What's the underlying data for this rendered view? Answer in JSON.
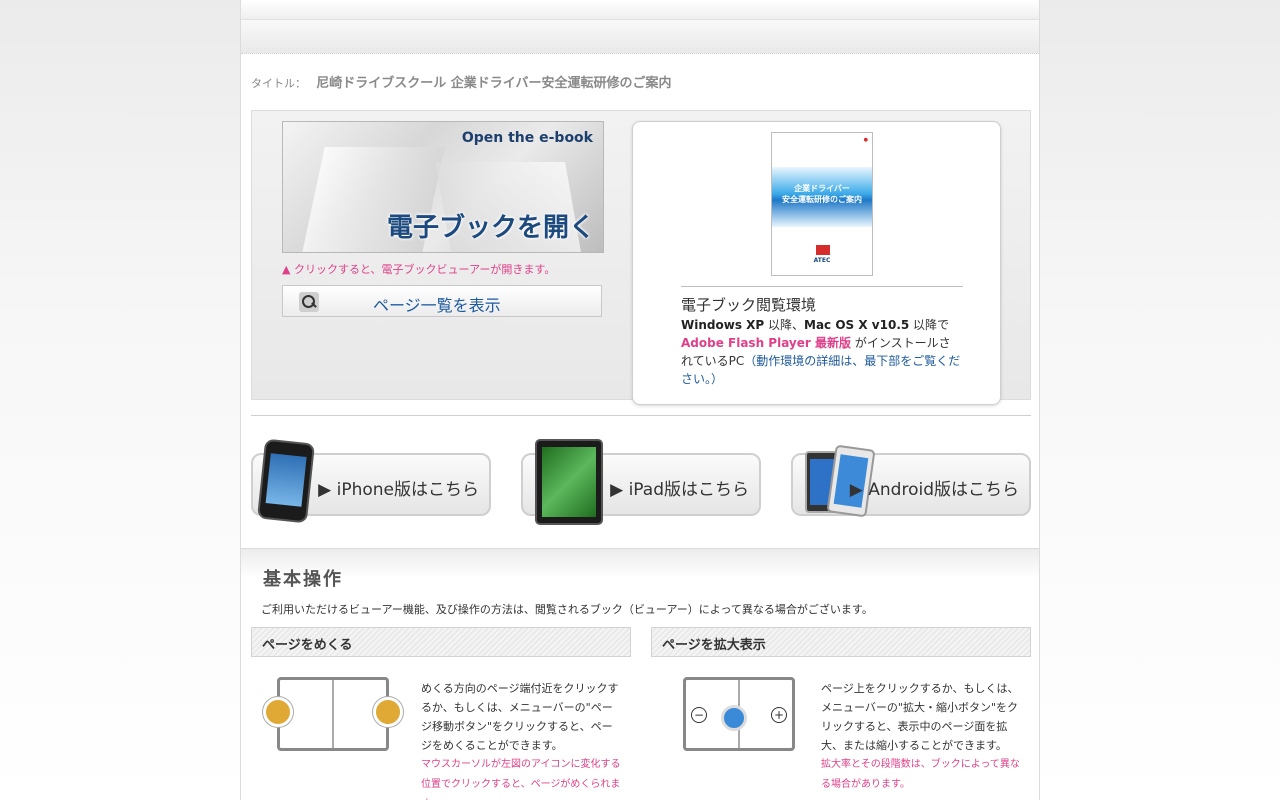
{
  "title": {
    "label": "タイトル：",
    "value": "尼崎ドライブスクール 企業ドライバー安全運転研修のご案内"
  },
  "open_book": {
    "en_label": "Open the e-book",
    "jp_label": "電子ブックを開く",
    "note": "▲ クリックすると、電子ブックビューアーが開きます。"
  },
  "page_list": {
    "label": "ページ一覧を表示"
  },
  "cover": {
    "title_line1": "企業ドライバー",
    "title_line2": "安全運転研修のご案内",
    "logo_text": "ATEC"
  },
  "environment": {
    "title": "電子ブック閲覧環境",
    "os_xp": "Windows XP",
    "os_connector": " 以降、",
    "os_mac": "Mac OS X v10.5",
    "os_suffix": " 以降で",
    "flash": "Adobe Flash Player 最新版",
    "installed": " がインストールされているPC",
    "detail": "（動作環境の詳細は、最下部をご覧ください。）"
  },
  "devices": [
    {
      "label": "▶ iPhone版はこちら"
    },
    {
      "label": "▶ iPad版はこちら"
    },
    {
      "label": "▶ Android版はこちら"
    }
  ],
  "operations": {
    "title": "基本操作",
    "description": "ご利用いただけるビューアー機能、及び操作の方法は、閲覧されるブック（ビューアー）によって異なる場合がございます。",
    "turn": {
      "heading": "ページをめくる",
      "text": "めくる方向のページ端付近をクリックするか、もしくは、メニューバーの\"ページ移動ボタン\"をクリックすると、ページをめくることができます。",
      "note": "マウスカーソルが左図のアイコンに変化する位置でクリックすると、ページがめくられます。"
    },
    "zoom": {
      "heading": "ページを拡大表示",
      "text": "ページ上をクリックするか、もしくは、メニューバーの\"拡大・縮小ボタン\"をクリックすると、表示中のページ面を拡大、または縮小することができます。",
      "note": "拡大率とその段階数は、ブックによって異なる場合があります。"
    }
  },
  "colors": {
    "accent_pink": "#e0408a",
    "accent_blue": "#1d5a9e"
  }
}
